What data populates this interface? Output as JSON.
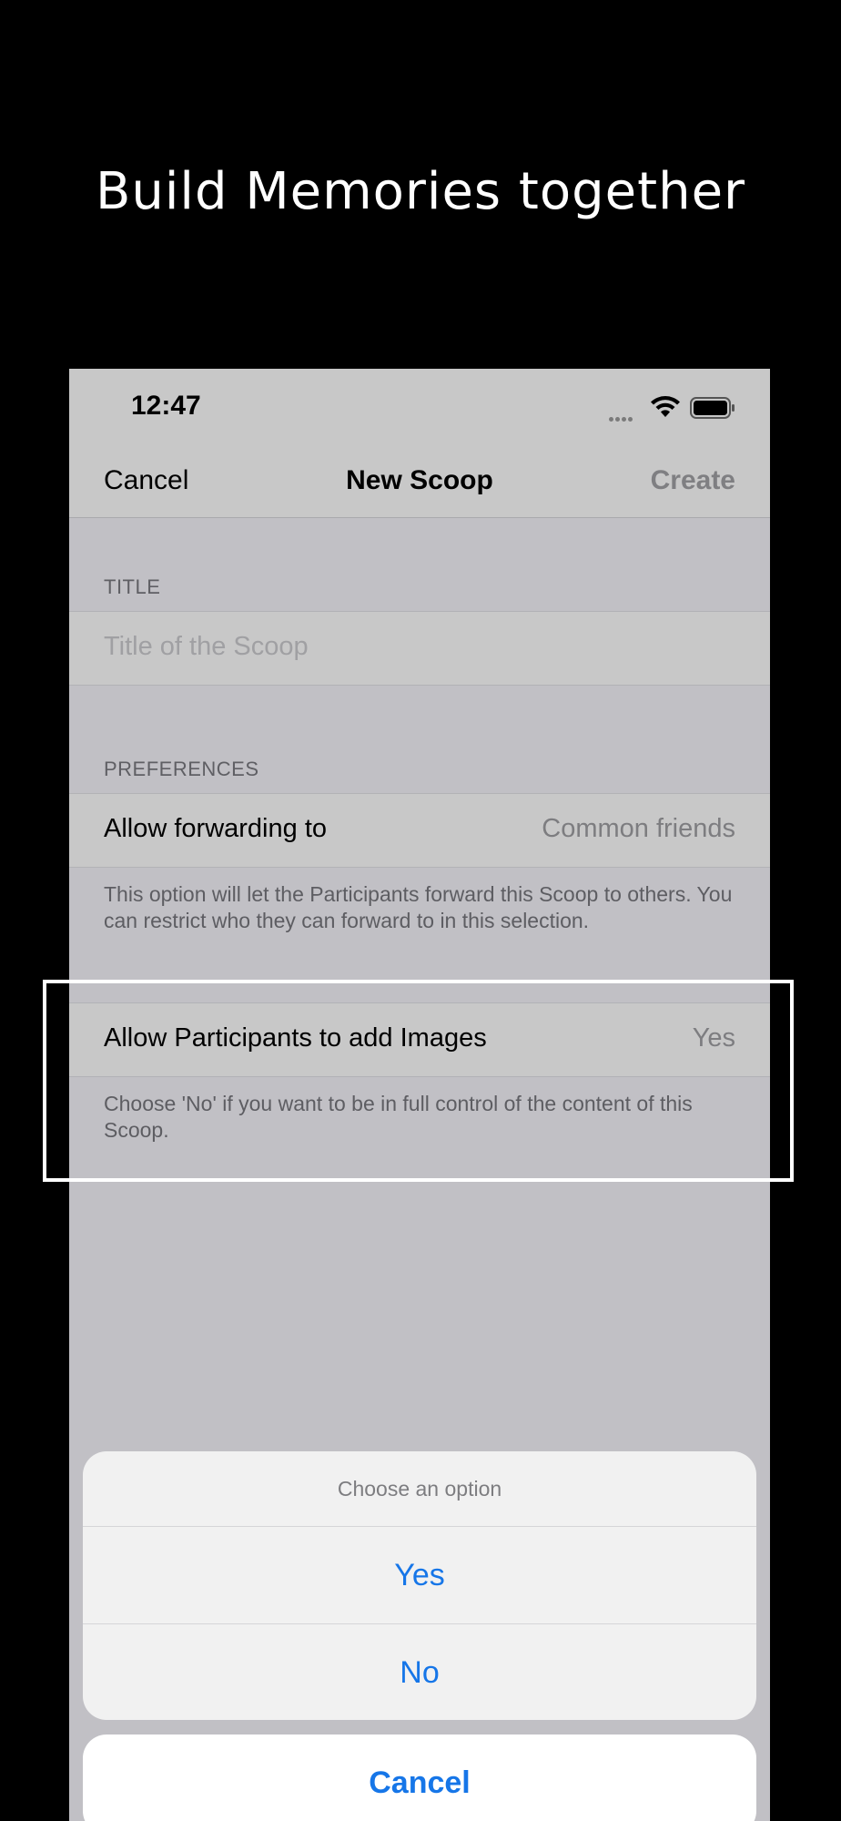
{
  "headline": "Build Memories together",
  "status_bar": {
    "time": "12:47"
  },
  "nav": {
    "cancel": "Cancel",
    "title": "New Scoop",
    "create": "Create"
  },
  "title_section": {
    "header": "TITLE",
    "placeholder": "Title of the Scoop"
  },
  "preferences_section": {
    "header": "PREFERENCES",
    "forwarding": {
      "label": "Allow forwarding to",
      "value": "Common friends"
    },
    "forwarding_footer": "This option will let the Participants forward this Scoop to others. You can restrict who they can forward to in this selection.",
    "images": {
      "label": "Allow Participants to add Images",
      "value": "Yes"
    },
    "images_footer": "Choose 'No' if you want to be in full control of the content of this Scoop."
  },
  "action_sheet": {
    "title": "Choose an option",
    "options": [
      "Yes",
      "No"
    ],
    "cancel": "Cancel"
  },
  "colors": {
    "accent": "#1676e8",
    "background": "#000000",
    "form_background": "#c1c0c5"
  }
}
